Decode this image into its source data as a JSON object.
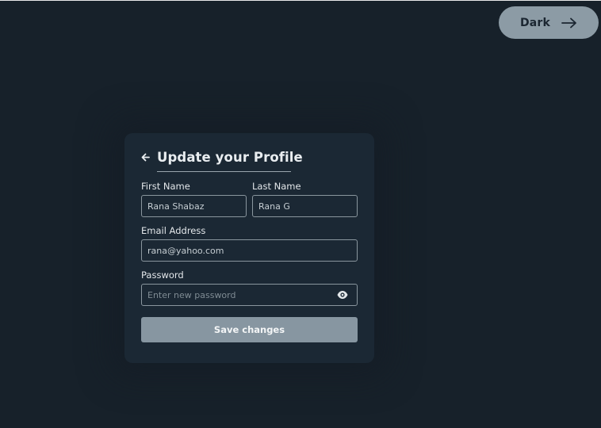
{
  "theme_toggle": {
    "label": "Dark",
    "icon": "arrow-right-icon"
  },
  "profile_form": {
    "title": "Update your Profile",
    "back_icon": "arrow-left-icon",
    "first_name": {
      "label": "First Name",
      "value": "Rana Shabaz"
    },
    "last_name": {
      "label": "Last Name",
      "value": "Rana G"
    },
    "email": {
      "label": "Email Address",
      "value": "rana@yahoo.com"
    },
    "password": {
      "label": "Password",
      "value": "",
      "placeholder": "Enter new password",
      "icon": "eye-icon"
    },
    "save_label": "Save changes"
  },
  "colors": {
    "background": "#17212a",
    "card": "#1b2834",
    "button": "#8796a1",
    "toggle": "#8c9ba5"
  }
}
